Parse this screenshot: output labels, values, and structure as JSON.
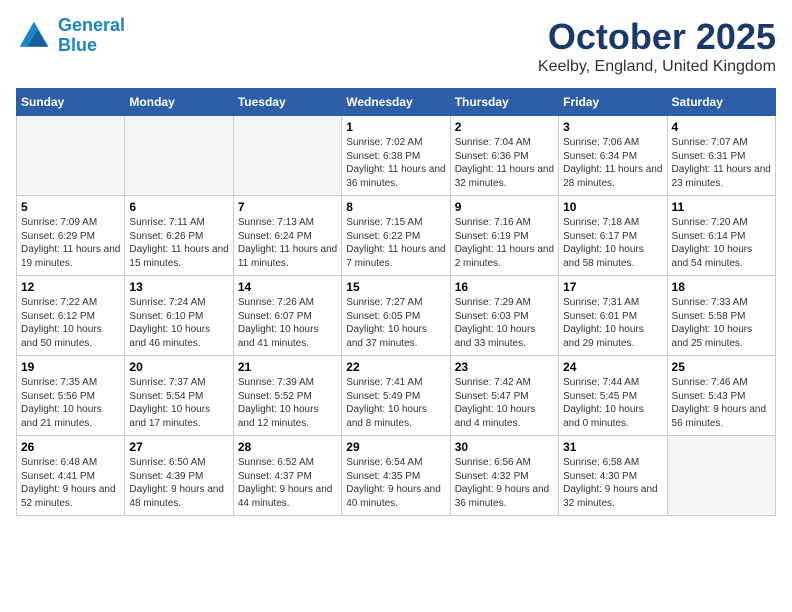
{
  "header": {
    "logo_line1": "General",
    "logo_line2": "Blue",
    "month": "October 2025",
    "location": "Keelby, England, United Kingdom"
  },
  "weekdays": [
    "Sunday",
    "Monday",
    "Tuesday",
    "Wednesday",
    "Thursday",
    "Friday",
    "Saturday"
  ],
  "weeks": [
    [
      {
        "day": "",
        "empty": true
      },
      {
        "day": "",
        "empty": true
      },
      {
        "day": "",
        "empty": true
      },
      {
        "day": "1",
        "sunrise": "7:02 AM",
        "sunset": "6:38 PM",
        "daylight": "11 hours and 36 minutes."
      },
      {
        "day": "2",
        "sunrise": "7:04 AM",
        "sunset": "6:36 PM",
        "daylight": "11 hours and 32 minutes."
      },
      {
        "day": "3",
        "sunrise": "7:06 AM",
        "sunset": "6:34 PM",
        "daylight": "11 hours and 28 minutes."
      },
      {
        "day": "4",
        "sunrise": "7:07 AM",
        "sunset": "6:31 PM",
        "daylight": "11 hours and 23 minutes."
      }
    ],
    [
      {
        "day": "5",
        "sunrise": "7:09 AM",
        "sunset": "6:29 PM",
        "daylight": "11 hours and 19 minutes."
      },
      {
        "day": "6",
        "sunrise": "7:11 AM",
        "sunset": "6:26 PM",
        "daylight": "11 hours and 15 minutes."
      },
      {
        "day": "7",
        "sunrise": "7:13 AM",
        "sunset": "6:24 PM",
        "daylight": "11 hours and 11 minutes."
      },
      {
        "day": "8",
        "sunrise": "7:15 AM",
        "sunset": "6:22 PM",
        "daylight": "11 hours and 7 minutes."
      },
      {
        "day": "9",
        "sunrise": "7:16 AM",
        "sunset": "6:19 PM",
        "daylight": "11 hours and 2 minutes."
      },
      {
        "day": "10",
        "sunrise": "7:18 AM",
        "sunset": "6:17 PM",
        "daylight": "10 hours and 58 minutes."
      },
      {
        "day": "11",
        "sunrise": "7:20 AM",
        "sunset": "6:14 PM",
        "daylight": "10 hours and 54 minutes."
      }
    ],
    [
      {
        "day": "12",
        "sunrise": "7:22 AM",
        "sunset": "6:12 PM",
        "daylight": "10 hours and 50 minutes."
      },
      {
        "day": "13",
        "sunrise": "7:24 AM",
        "sunset": "6:10 PM",
        "daylight": "10 hours and 46 minutes."
      },
      {
        "day": "14",
        "sunrise": "7:26 AM",
        "sunset": "6:07 PM",
        "daylight": "10 hours and 41 minutes."
      },
      {
        "day": "15",
        "sunrise": "7:27 AM",
        "sunset": "6:05 PM",
        "daylight": "10 hours and 37 minutes."
      },
      {
        "day": "16",
        "sunrise": "7:29 AM",
        "sunset": "6:03 PM",
        "daylight": "10 hours and 33 minutes."
      },
      {
        "day": "17",
        "sunrise": "7:31 AM",
        "sunset": "6:01 PM",
        "daylight": "10 hours and 29 minutes."
      },
      {
        "day": "18",
        "sunrise": "7:33 AM",
        "sunset": "5:58 PM",
        "daylight": "10 hours and 25 minutes."
      }
    ],
    [
      {
        "day": "19",
        "sunrise": "7:35 AM",
        "sunset": "5:56 PM",
        "daylight": "10 hours and 21 minutes."
      },
      {
        "day": "20",
        "sunrise": "7:37 AM",
        "sunset": "5:54 PM",
        "daylight": "10 hours and 17 minutes."
      },
      {
        "day": "21",
        "sunrise": "7:39 AM",
        "sunset": "5:52 PM",
        "daylight": "10 hours and 12 minutes."
      },
      {
        "day": "22",
        "sunrise": "7:41 AM",
        "sunset": "5:49 PM",
        "daylight": "10 hours and 8 minutes."
      },
      {
        "day": "23",
        "sunrise": "7:42 AM",
        "sunset": "5:47 PM",
        "daylight": "10 hours and 4 minutes."
      },
      {
        "day": "24",
        "sunrise": "7:44 AM",
        "sunset": "5:45 PM",
        "daylight": "10 hours and 0 minutes."
      },
      {
        "day": "25",
        "sunrise": "7:46 AM",
        "sunset": "5:43 PM",
        "daylight": "9 hours and 56 minutes."
      }
    ],
    [
      {
        "day": "26",
        "sunrise": "6:48 AM",
        "sunset": "4:41 PM",
        "daylight": "9 hours and 52 minutes."
      },
      {
        "day": "27",
        "sunrise": "6:50 AM",
        "sunset": "4:39 PM",
        "daylight": "9 hours and 48 minutes."
      },
      {
        "day": "28",
        "sunrise": "6:52 AM",
        "sunset": "4:37 PM",
        "daylight": "9 hours and 44 minutes."
      },
      {
        "day": "29",
        "sunrise": "6:54 AM",
        "sunset": "4:35 PM",
        "daylight": "9 hours and 40 minutes."
      },
      {
        "day": "30",
        "sunrise": "6:56 AM",
        "sunset": "4:32 PM",
        "daylight": "9 hours and 36 minutes."
      },
      {
        "day": "31",
        "sunrise": "6:58 AM",
        "sunset": "4:30 PM",
        "daylight": "9 hours and 32 minutes."
      },
      {
        "day": "",
        "empty": true
      }
    ]
  ]
}
